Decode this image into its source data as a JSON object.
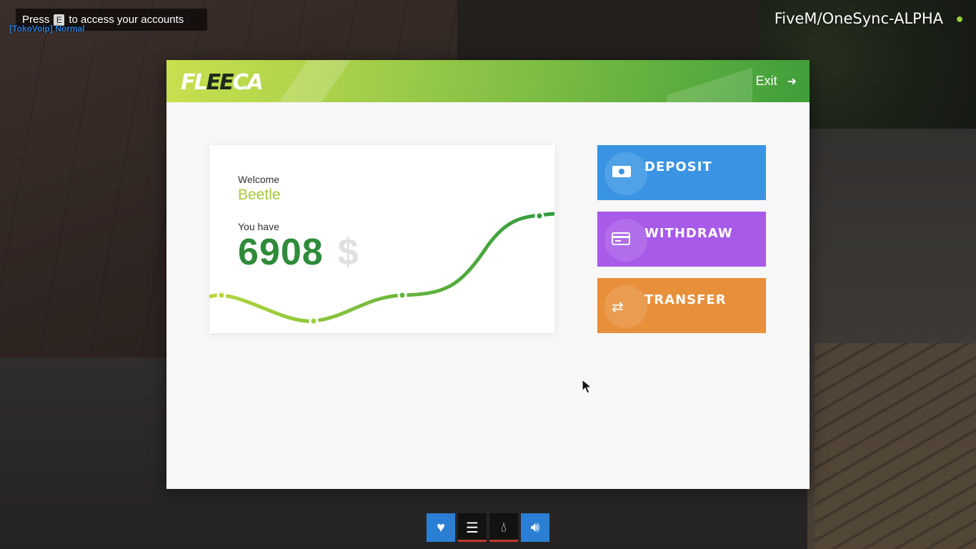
{
  "hud": {
    "hint_prefix": "Press",
    "hint_key": "E",
    "hint_suffix": "to access your accounts",
    "voip_status": "[TokoVoip] Normal",
    "server_name": "FiveM/OneSync-ALPHA"
  },
  "bank": {
    "brand_left": "FL",
    "brand_mid": "EE",
    "brand_right": "CA",
    "exit_label": "Exit",
    "welcome_label": "Welcome",
    "username": "Beetle",
    "you_have_label": "You have",
    "balance": "6908",
    "currency_symbol": "$",
    "actions": [
      {
        "label": "DEPOSIT",
        "icon": "cash-icon",
        "color": "#3a94e3"
      },
      {
        "label": "WITHDRAW",
        "icon": "card-icon",
        "color": "#a85ae8"
      },
      {
        "label": "TRANSFER",
        "icon": "transfer-arrows-icon",
        "color": "#e88f3a"
      }
    ]
  },
  "status": [
    {
      "name": "health-icon",
      "level": 1.0,
      "color": "#2a7fd4"
    },
    {
      "name": "hunger-icon",
      "level": 0.08,
      "color": "#c0392b"
    },
    {
      "name": "thirst-icon",
      "level": 0.08,
      "color": "#c0392b"
    },
    {
      "name": "voice-icon",
      "level": 1.0,
      "color": "#2a7fd4"
    }
  ]
}
